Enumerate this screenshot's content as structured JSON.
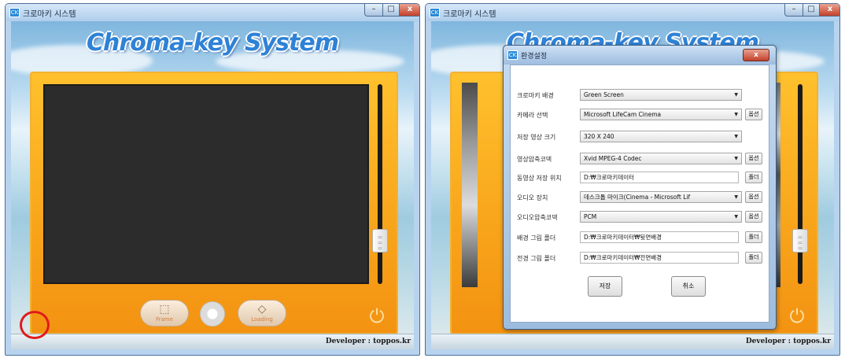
{
  "left_window": {
    "title": "크로마키 시스템",
    "app_title": "Chroma-key System",
    "controls": {
      "minimize": "–",
      "maximize": "□",
      "close": "x"
    },
    "buttons": {
      "frame": "Frame",
      "loading": "Loading"
    },
    "developer": "Developer : toppos.kr"
  },
  "right_window": {
    "title": "크로마키 시스템",
    "app_title": "Chroma-key System",
    "controls": {
      "minimize": "–",
      "maximize": "□",
      "close": "x"
    },
    "developer": "Developer : toppos.kr"
  },
  "settings_dialog": {
    "title": "환경설정",
    "close": "x",
    "rows": [
      {
        "label": "크로마키 배경",
        "value": "Green Screen"
      },
      {
        "label": "카메라 선택",
        "value": "Microsoft LifeCam Cinema",
        "option": "옵션"
      },
      {
        "label": "저장 영상 크기",
        "value": "320 X 240"
      },
      {
        "label": "영상압축코덱",
        "value": "Xvid MPEG-4 Codec",
        "option": "옵션"
      },
      {
        "label": "동영상 저장 위치",
        "value": "D:₩크로마키데이터",
        "option": "폴더"
      },
      {
        "label": "오디오 장치",
        "value": "데스크톱 마이크(Cinema - Microsoft Lif",
        "option": "옵션"
      },
      {
        "label": "오디오압축코덱",
        "value": "PCM",
        "option": "옵션"
      },
      {
        "label": "배경 그림 폴더",
        "value": "D:₩크로마키데이터₩뒷면배경",
        "option": "폴더"
      },
      {
        "label": "전경 그림 폴더",
        "value": "D:₩크로마키데이터₩전면배경",
        "option": "폴더"
      }
    ],
    "save": "저장",
    "cancel": "취소"
  },
  "colors": {
    "accent_orange": "#f8a41a",
    "highlight_red": "#e01b1b",
    "title_blue": "#2e82d6"
  }
}
